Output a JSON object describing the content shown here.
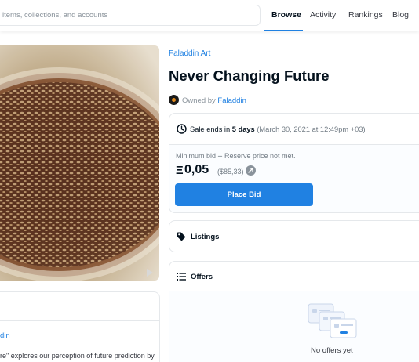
{
  "header": {
    "search_placeholder": "items, collections, and accounts",
    "nav": [
      "Browse",
      "Activity",
      "Rankings",
      "Blog"
    ],
    "active_nav": "Browse"
  },
  "item": {
    "collection": "Faladdin Art",
    "title": "Never Changing Future",
    "owned_by_prefix": "Owned by",
    "owner": "Faladdin"
  },
  "sale": {
    "prefix": "Sale ends in",
    "remaining": "5 days",
    "date": "(March 30, 2021 at 12:49pm +03)",
    "min_bid_text": "Minimum bid -- Reserve price not met.",
    "currency_symbol": "Ξ",
    "price": "0,05",
    "usd": "($85,33)",
    "button_label": "Place Bid"
  },
  "listings": {
    "label": "Listings"
  },
  "offers": {
    "label": "Offers",
    "empty_text": "No offers yet"
  },
  "description": {
    "creator_fragment": "din",
    "text_fragment": "re\" explores our perception of future prediction by"
  },
  "colors": {
    "accent": "#2081e2",
    "border": "#e5e8eb",
    "muted": "#707a83"
  }
}
